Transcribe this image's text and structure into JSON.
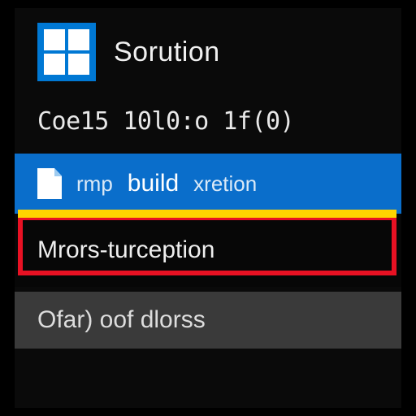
{
  "header": {
    "title": "Sorution"
  },
  "code_line": "Coe15 10l0:o 1f(0)",
  "build": {
    "prefix": "rmp",
    "label": "build",
    "secondary": "xretion"
  },
  "error": {
    "label": "Mrors-turception"
  },
  "status": {
    "label": "Ofar) oof dlorss"
  },
  "colors": {
    "accent": "#0a6ecb",
    "error": "#e81123",
    "warning": "#ffd400",
    "panel": "#3a3a3a"
  }
}
